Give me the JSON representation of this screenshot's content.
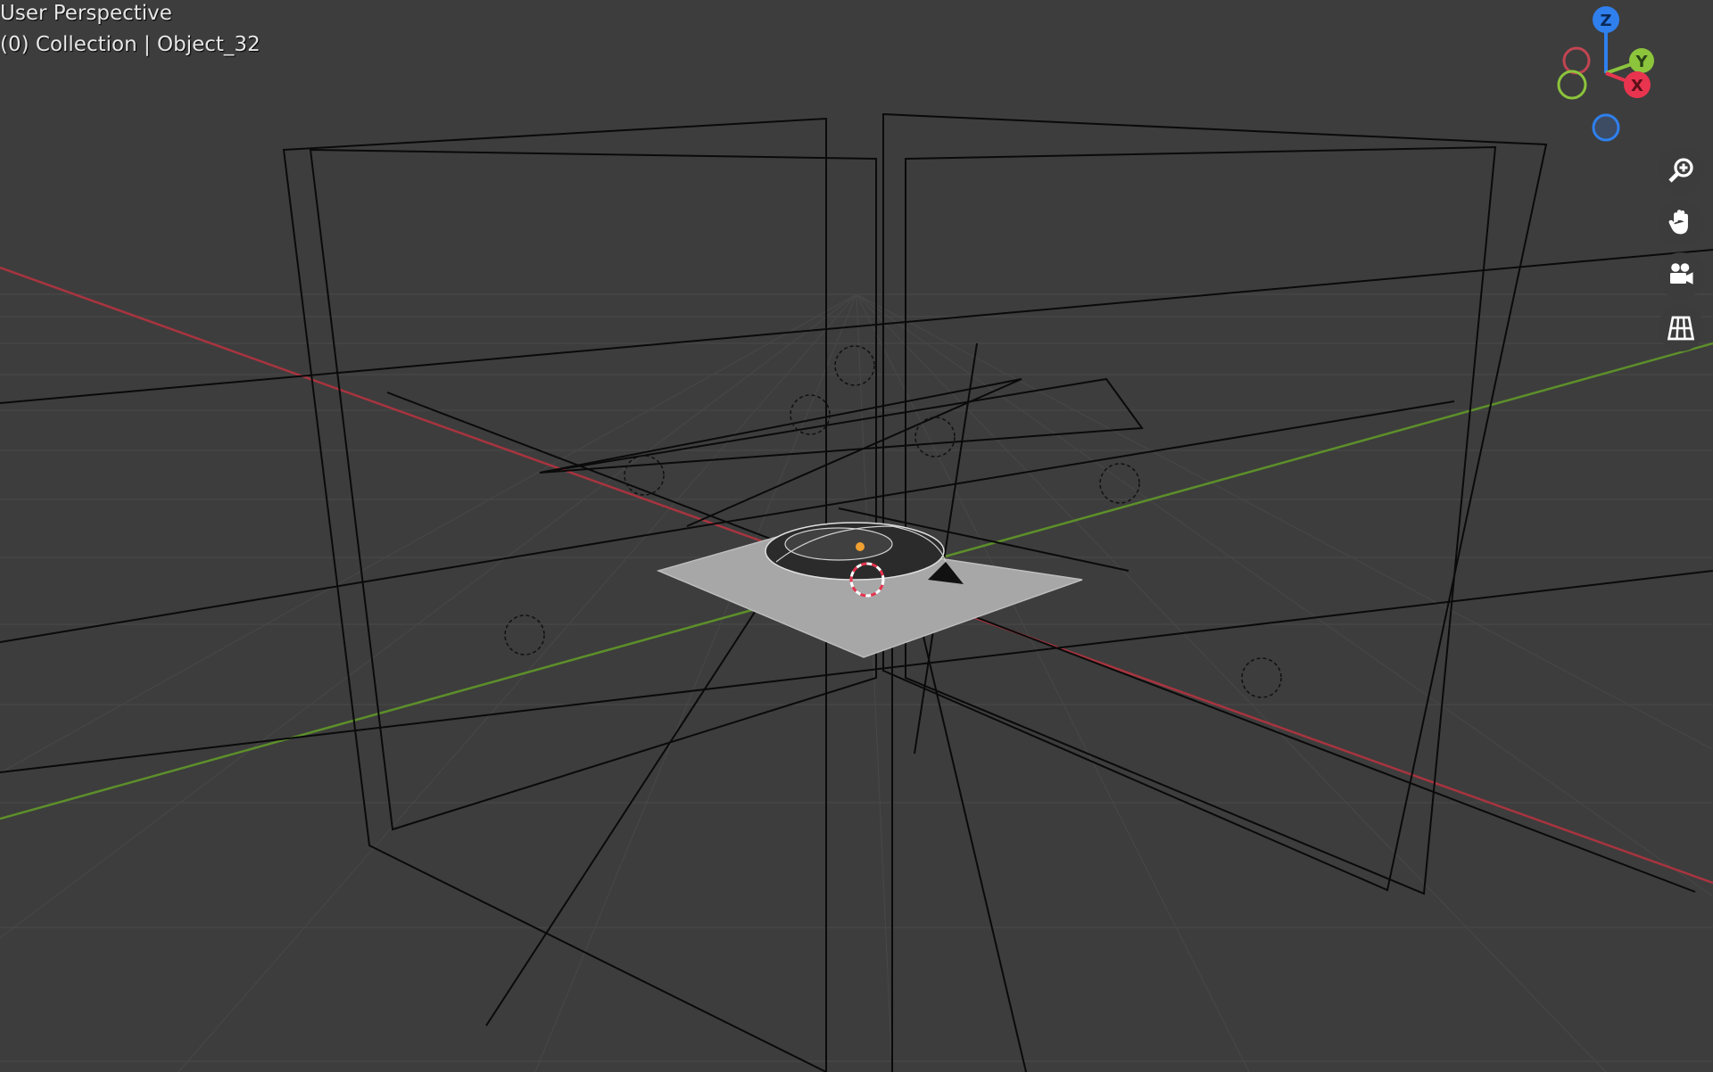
{
  "viewport": {
    "view_mode": "User Perspective",
    "object_info": "(0) Collection | Object_32"
  },
  "gizmo": {
    "axes": [
      {
        "label": "Z",
        "color": "#2f80ed"
      },
      {
        "label": "Y",
        "color": "#8cc43c"
      },
      {
        "label": "X",
        "color": "#e8344f"
      }
    ]
  },
  "nav_buttons": [
    {
      "icon": "zoom-in-icon"
    },
    {
      "icon": "hand-pan-icon"
    },
    {
      "icon": "camera-view-icon"
    },
    {
      "icon": "perspective-grid-icon"
    }
  ],
  "colors": {
    "background": "#3d3d3d",
    "grid": "#4a4a4a",
    "x_axis": "#a8343f",
    "y_axis": "#5d8f2a",
    "wire": "#0a0a0a"
  }
}
